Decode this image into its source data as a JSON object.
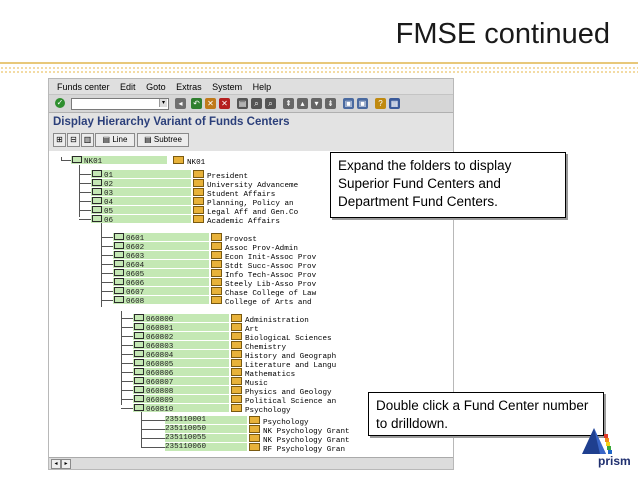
{
  "slide": {
    "title": "FMSE continued",
    "callout_expand": "Expand the folders to display Superior Fund Centers and Department Fund Centers.",
    "callout_drill": "Double click a Fund Center number to drilldown.",
    "logo_text": "prism"
  },
  "sap": {
    "menu": [
      "Funds center",
      "Edit",
      "Goto",
      "Extras",
      "System",
      "Help"
    ],
    "title": "Display Hierarchy Variant of Funds Centers",
    "appbar": {
      "line_label": "Line",
      "subtree_label": "Subtree"
    }
  },
  "tree": {
    "root": {
      "id": "NK01",
      "desc": "NK01"
    },
    "level1": [
      {
        "id": "01",
        "desc": "President"
      },
      {
        "id": "02",
        "desc": "University Advanceme"
      },
      {
        "id": "03",
        "desc": "Student Affairs"
      },
      {
        "id": "04",
        "desc": "Planning, Policy an"
      },
      {
        "id": "05",
        "desc": "Legal Aff and Gen.Co"
      },
      {
        "id": "06",
        "desc": "Academic Affairs"
      }
    ],
    "level2": [
      {
        "id": "0601",
        "desc": "Provost"
      },
      {
        "id": "0602",
        "desc": "Assoc Prov-Admin"
      },
      {
        "id": "0603",
        "desc": "Econ Init-Assoc Prov"
      },
      {
        "id": "0604",
        "desc": "Stdt Succ-Assoc Prov"
      },
      {
        "id": "0605",
        "desc": "Info Tech-Assoc Prov"
      },
      {
        "id": "0606",
        "desc": "Steely Lib-Asso Prov"
      },
      {
        "id": "0607",
        "desc": "Chase College of Law"
      },
      {
        "id": "0608",
        "desc": "College of Arts and"
      }
    ],
    "level3": [
      {
        "id": "060800",
        "desc": "Administration"
      },
      {
        "id": "060801",
        "desc": "Art"
      },
      {
        "id": "060802",
        "desc": "BiologicaL Sciences"
      },
      {
        "id": "060803",
        "desc": "Chemistry"
      },
      {
        "id": "060804",
        "desc": "History and Geograph"
      },
      {
        "id": "060805",
        "desc": "Literature and Langu"
      },
      {
        "id": "060806",
        "desc": "Mathematics"
      },
      {
        "id": "060807",
        "desc": "Music"
      },
      {
        "id": "060808",
        "desc": "Physics and Geology"
      },
      {
        "id": "060809",
        "desc": "Political Science an"
      },
      {
        "id": "060810",
        "desc": "Psychology"
      }
    ],
    "level4": [
      {
        "id": "235110001",
        "desc": "Psychology"
      },
      {
        "id": "235110050",
        "desc": "NK Psychology Grant"
      },
      {
        "id": "235110055",
        "desc": "NK Psychology Grant"
      },
      {
        "id": "235110060",
        "desc": "RF Psychology Gran"
      }
    ]
  }
}
